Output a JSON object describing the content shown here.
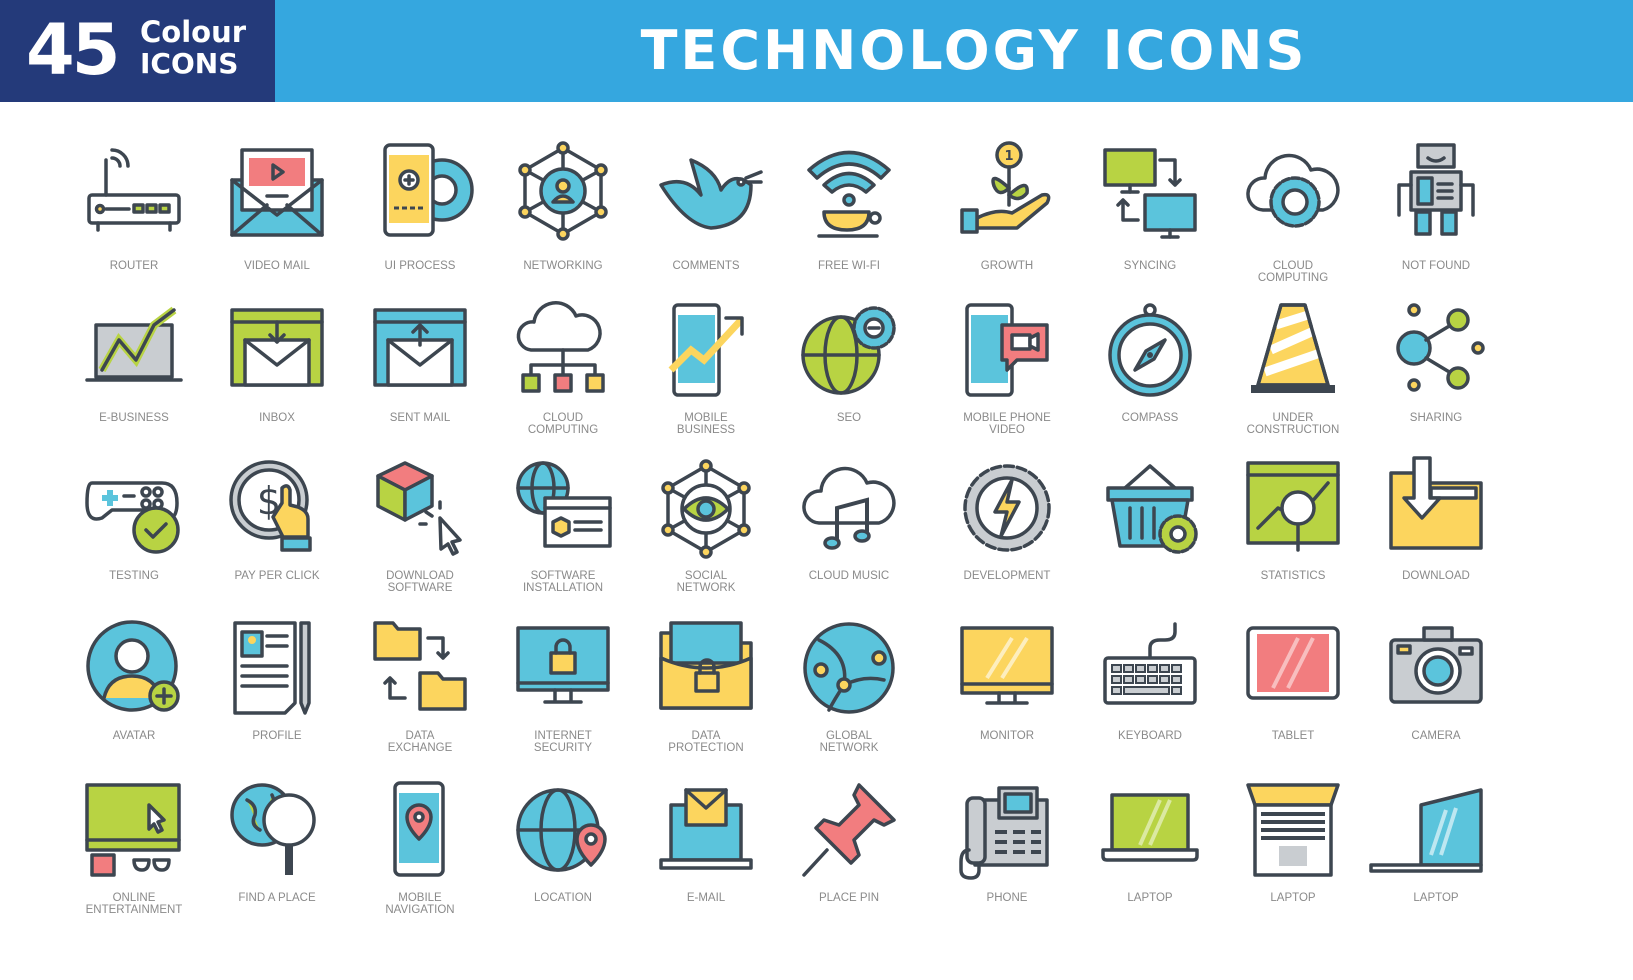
{
  "header": {
    "badge_number": "45",
    "badge_line1": "Colour",
    "badge_line2": "ICONS",
    "title": "TECHNOLOGY ICONS"
  },
  "colors": {
    "header_blue": "#35a7df",
    "badge_navy": "#243a7a",
    "icon_outline": "#3d4650",
    "icon_blue": "#5bc4dc",
    "icon_green": "#b8d343",
    "icon_yellow": "#fcd55e",
    "icon_pink": "#f27d7f",
    "icon_grey": "#c9cdd1",
    "label_grey": "#8a8a8a"
  },
  "rows": [
    [
      {
        "label": [
          "ROUTER"
        ],
        "icon": "router-icon"
      },
      {
        "label": [
          "VIDEO MAIL"
        ],
        "icon": "video-mail-icon"
      },
      {
        "label": [
          "UI PROCESS"
        ],
        "icon": "ui-process-icon"
      },
      {
        "label": [
          "NETWORKING"
        ],
        "icon": "networking-icon"
      },
      {
        "label": [
          "COMMENTS"
        ],
        "icon": "bird-icon"
      },
      {
        "label": [
          "FREE WI-FI"
        ],
        "icon": "wifi-cup-icon"
      },
      {
        "label": [
          "GROWTH"
        ],
        "icon": "growth-icon"
      },
      {
        "label": [
          "SYNCING"
        ],
        "icon": "syncing-icon"
      },
      {
        "label": [
          "CLOUD",
          "COMPUTING"
        ],
        "icon": "cloud-gear-icon"
      },
      {
        "label": [
          "NOT FOUND"
        ],
        "icon": "robot-icon"
      }
    ],
    [
      {
        "label": [
          "E-BUSINESS"
        ],
        "icon": "e-business-icon"
      },
      {
        "label": [
          "INBOX"
        ],
        "icon": "inbox-icon"
      },
      {
        "label": [
          "SENT MAIL"
        ],
        "icon": "sent-mail-icon"
      },
      {
        "label": [
          "CLOUD",
          "COMPUTING"
        ],
        "icon": "cloud-network-icon"
      },
      {
        "label": [
          "MOBILE",
          "BUSINESS"
        ],
        "icon": "mobile-business-icon"
      },
      {
        "label": [
          "SEO"
        ],
        "icon": "seo-globe-icon"
      },
      {
        "label": [
          "MOBILE PHONE",
          "VIDEO"
        ],
        "icon": "mobile-video-icon"
      },
      {
        "label": [
          "COMPASS"
        ],
        "icon": "compass-icon"
      },
      {
        "label": [
          "UNDER",
          "CONSTRUCTION"
        ],
        "icon": "traffic-cone-icon"
      },
      {
        "label": [
          "SHARING"
        ],
        "icon": "sharing-icon"
      }
    ],
    [
      {
        "label": [
          "TESTING"
        ],
        "icon": "gamepad-check-icon"
      },
      {
        "label": [
          "PAY PER CLICK"
        ],
        "icon": "pay-per-click-icon"
      },
      {
        "label": [
          "DOWNLOAD",
          "SOFTWARE"
        ],
        "icon": "cube-cursor-icon"
      },
      {
        "label": [
          "SOFTWARE",
          "INSTALLATION"
        ],
        "icon": "software-installation-icon"
      },
      {
        "label": [
          "SOCIAL",
          "NETWORK"
        ],
        "icon": "social-eye-icon"
      },
      {
        "label": [
          "CLOUD MUSIC"
        ],
        "icon": "cloud-music-icon"
      },
      {
        "label": [
          "DEVELOPMENT"
        ],
        "icon": "gear-bolt-icon"
      },
      {
        "label": [
          ""
        ],
        "icon": "basket-gear-icon"
      },
      {
        "label": [
          "STATISTICS"
        ],
        "icon": "statistics-icon"
      },
      {
        "label": [
          "DOWNLOAD"
        ],
        "icon": "folder-download-icon"
      }
    ],
    [
      {
        "label": [
          "AVATAR"
        ],
        "icon": "avatar-icon"
      },
      {
        "label": [
          "PROFILE"
        ],
        "icon": "profile-doc-icon"
      },
      {
        "label": [
          "DATA",
          "EXCHANGE"
        ],
        "icon": "data-exchange-icon"
      },
      {
        "label": [
          "INTERNET",
          "SECURITY"
        ],
        "icon": "monitor-lock-icon"
      },
      {
        "label": [
          "DATA",
          "PROTECTION"
        ],
        "icon": "folder-lock-icon"
      },
      {
        "label": [
          "GLOBAL",
          "NETWORK"
        ],
        "icon": "global-network-icon"
      },
      {
        "label": [
          "MONITOR"
        ],
        "icon": "monitor-icon"
      },
      {
        "label": [
          "KEYBOARD"
        ],
        "icon": "keyboard-icon"
      },
      {
        "label": [
          "TABLET"
        ],
        "icon": "tablet-icon"
      },
      {
        "label": [
          "CAMERA"
        ],
        "icon": "camera-icon"
      }
    ],
    [
      {
        "label": [
          "ONLINE",
          "ENTERTAINMENT"
        ],
        "icon": "online-entertainment-icon"
      },
      {
        "label": [
          "FIND A PLACE"
        ],
        "icon": "find-place-icon"
      },
      {
        "label": [
          "MOBILE",
          "NAVIGATION"
        ],
        "icon": "mobile-navigation-icon"
      },
      {
        "label": [
          "LOCATION"
        ],
        "icon": "globe-pin-icon"
      },
      {
        "label": [
          "E-MAIL"
        ],
        "icon": "laptop-mail-icon"
      },
      {
        "label": [
          "PLACE PIN"
        ],
        "icon": "push-pin-icon"
      },
      {
        "label": [
          "PHONE"
        ],
        "icon": "desk-phone-icon"
      },
      {
        "label": [
          "LAPTOP"
        ],
        "icon": "laptop-green-icon"
      },
      {
        "label": [
          "LAPTOP"
        ],
        "icon": "laptop-keyboard-icon"
      },
      {
        "label": [
          "LAPTOP"
        ],
        "icon": "laptop-side-icon"
      }
    ]
  ]
}
